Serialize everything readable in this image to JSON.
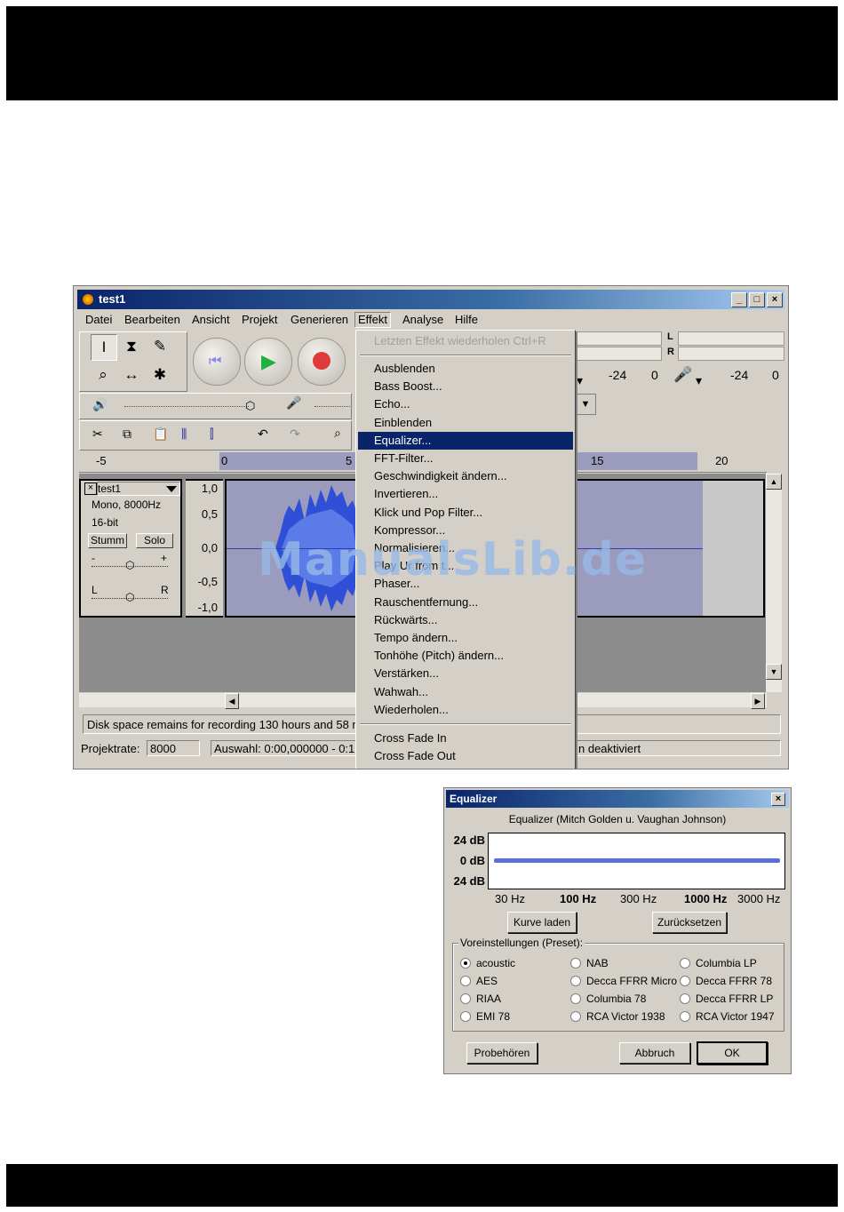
{
  "audacity": {
    "title": "test1",
    "window_buttons": {
      "minimize": "_",
      "maximize": "□",
      "close": "×"
    },
    "menu": [
      "Datei",
      "Bearbeiten",
      "Ansicht",
      "Projekt",
      "Generieren",
      "Effekt",
      "Analyse",
      "Hilfe"
    ],
    "meter": {
      "labels": [
        "L",
        "R"
      ],
      "scale_left": [
        "-24",
        "0"
      ],
      "scale_right": [
        "-24",
        "0"
      ]
    },
    "ruler_ticks": [
      "-5",
      "0",
      "5",
      "15",
      "20"
    ],
    "track": {
      "name": "test1",
      "info1": "Mono, 8000Hz",
      "info2": "16-bit",
      "mute": "Stumm",
      "solo": "Solo",
      "gain_minus": "-",
      "gain_plus": "+",
      "pan_left": "L",
      "pan_right": "R",
      "scale": [
        "1,0",
        "0,5",
        "0,0",
        "-0,5",
        "-1,0"
      ]
    },
    "status_text": "Disk space remains for recording 130 hours and 58 m",
    "projektrate_label": "Projektrate:",
    "projektrate_value": "8000",
    "auswahl": "Auswahl: 0:00,000000 - 0:1",
    "snap_status": "n deaktiviert",
    "effekt_menu": {
      "repeat": "Letzten Effekt wiederholen   Ctrl+R",
      "items": [
        "Ausblenden",
        "Bass Boost...",
        "Echo...",
        "Einblenden",
        "Equalizer...",
        "FFT-Filter...",
        "Geschwindigkeit ändern...",
        "Invertieren...",
        "Klick und Pop Filter...",
        "Kompressor...",
        "Normalisieren...",
        "Phaser...",
        "Rauschentfernung...",
        "Rückwärts...",
        "Tempo ändern...",
        "Tonhöhe (Pitch) ändern...",
        "Verstärken...",
        "Wahwah...",
        "Wiederholen..."
      ],
      "partial_item": "Play Ur from t...",
      "highlighted": "Equalizer...",
      "extra_items": [
        "Cross Fade In",
        "Cross Fade Out"
      ]
    }
  },
  "watermark": "ManualsLib.de",
  "equalizer": {
    "title": "Equalizer",
    "close": "×",
    "subtitle": "Equalizer (Mitch Golden u. Vaughan Johnson)",
    "db_labels": [
      "24 dB",
      "0 dB",
      "24 dB"
    ],
    "hz_labels": [
      "30 Hz",
      "100 Hz",
      "300 Hz",
      "1000 Hz",
      "3000 Hz"
    ],
    "load_curve": "Kurve laden",
    "reset": "Zurücksetzen",
    "preset_label": "Voreinstellungen (Preset):",
    "presets": [
      [
        "acoustic",
        "NAB",
        "Columbia LP"
      ],
      [
        "AES",
        "Decca FFRR Micro",
        "Decca FFRR 78"
      ],
      [
        "RIAA",
        "Columbia 78",
        "Decca FFRR LP"
      ],
      [
        "EMI 78",
        "RCA Victor 1938",
        "RCA Victor 1947"
      ]
    ],
    "selected_preset": "acoustic",
    "preview": "Probehören",
    "cancel": "Abbruch",
    "ok": "OK",
    "curve_color": "#5a6fd8"
  }
}
